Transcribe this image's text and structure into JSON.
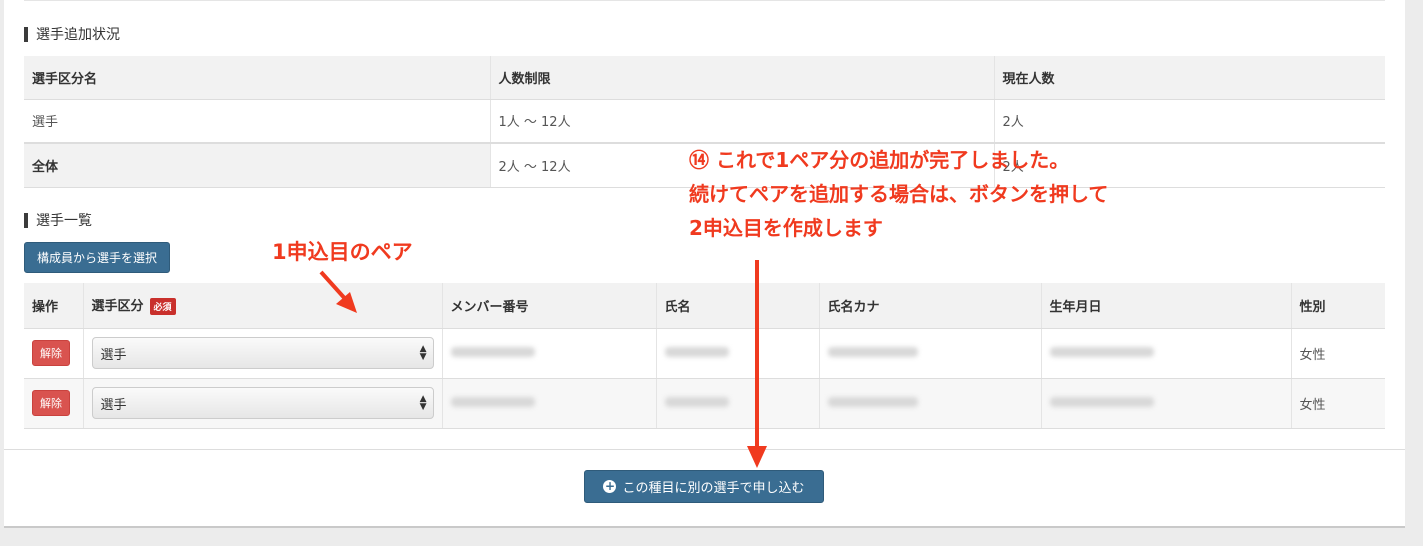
{
  "status_section": {
    "title": "選手追加状況",
    "headers": [
      "選手区分名",
      "人数制限",
      "現在人数"
    ],
    "rows": [
      [
        "選手",
        "1人 〜 12人",
        "2人"
      ],
      [
        "全体",
        "2人 〜 12人",
        "2人"
      ]
    ]
  },
  "list_section": {
    "title": "選手一覧",
    "select_member_button": "構成員から選手を選択",
    "headers": {
      "action": "操作",
      "category": "選手区分",
      "required": "必須",
      "member_no": "メンバー番号",
      "name": "氏名",
      "kana": "氏名カナ",
      "birthdate": "生年月日",
      "gender": "性別"
    },
    "rows": [
      {
        "remove": "解除",
        "category": "選手",
        "gender": "女性"
      },
      {
        "remove": "解除",
        "category": "選手",
        "gender": "女性"
      }
    ]
  },
  "add_button": "この種目に別の選手で申し込む",
  "annotations": {
    "pair_label": "1申込目のペア",
    "lines": [
      "⑭ これで1ペア分の追加が完了しました。",
      "続けてペアを追加する場合は、ボタンを押して",
      "2申込目を作成します"
    ]
  },
  "colors": {
    "primary_button": "#3a6d92",
    "danger_button": "#d9534f",
    "annotation": "#f03a1f"
  }
}
